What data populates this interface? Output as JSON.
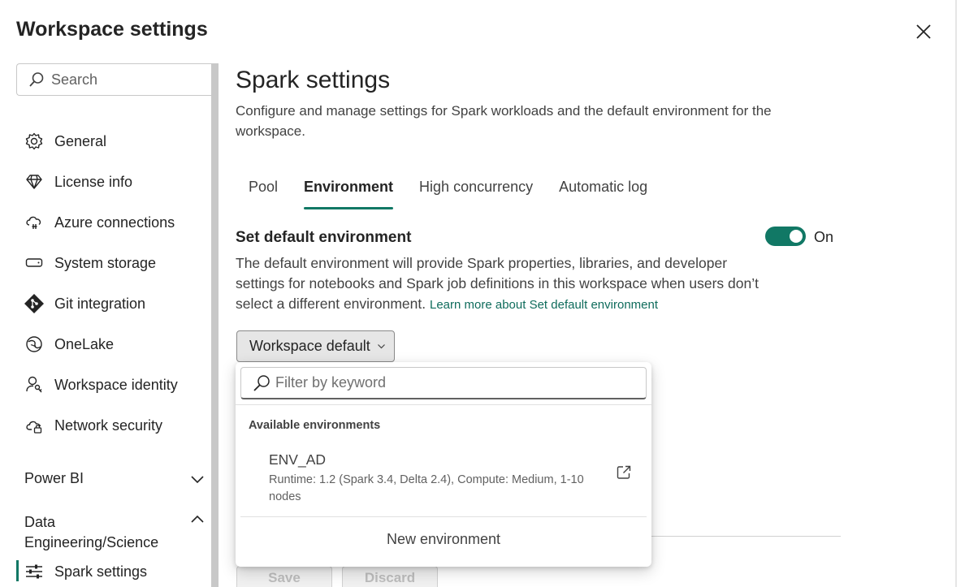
{
  "dialog": {
    "title": "Workspace settings"
  },
  "sidebar": {
    "search_placeholder": "Search",
    "items": [
      {
        "label": "General",
        "icon": "gear-icon"
      },
      {
        "label": "License info",
        "icon": "diamond-icon"
      },
      {
        "label": "Azure connections",
        "icon": "cloud-plug-icon"
      },
      {
        "label": "System storage",
        "icon": "storage-icon"
      },
      {
        "label": "Git integration",
        "icon": "git-icon"
      },
      {
        "label": "OneLake",
        "icon": "onelake-icon"
      },
      {
        "label": "Workspace identity",
        "icon": "identity-icon"
      },
      {
        "label": "Network security",
        "icon": "cloud-lock-icon"
      }
    ],
    "sections": [
      {
        "label": "Power BI",
        "expanded": false
      },
      {
        "label": "Data Engineering/Science",
        "expanded": true
      }
    ],
    "active_item": {
      "label": "Spark settings",
      "icon": "sliders-icon"
    }
  },
  "main": {
    "title": "Spark settings",
    "description": "Configure and manage settings for Spark workloads and the default environment for the workspace.",
    "tabs": [
      {
        "label": "Pool",
        "active": false
      },
      {
        "label": "Environment",
        "active": true
      },
      {
        "label": "High concurrency",
        "active": false
      },
      {
        "label": "Automatic log",
        "active": false
      }
    ],
    "section": {
      "title": "Set default environment",
      "toggle_state": "On",
      "description": "The default environment will provide Spark properties, libraries, and developer settings for notebooks and Spark job definitions in this workspace when users don’t select a different environment.",
      "learn_more": "Learn more about Set default environment"
    },
    "dropdown": {
      "selected": "Workspace default"
    },
    "buttons": {
      "save": "Save",
      "discard": "Discard"
    }
  },
  "popup": {
    "filter_placeholder": "Filter by keyword",
    "group_label": "Available environments",
    "environments": [
      {
        "name": "ENV_AD",
        "detail": "Runtime: 1.2 (Spark 3.4, Delta 2.4), Compute: Medium, 1-10 nodes"
      }
    ],
    "new_environment": "New environment"
  },
  "colors": {
    "accent": "#117865",
    "link": "#0f6c5c"
  }
}
